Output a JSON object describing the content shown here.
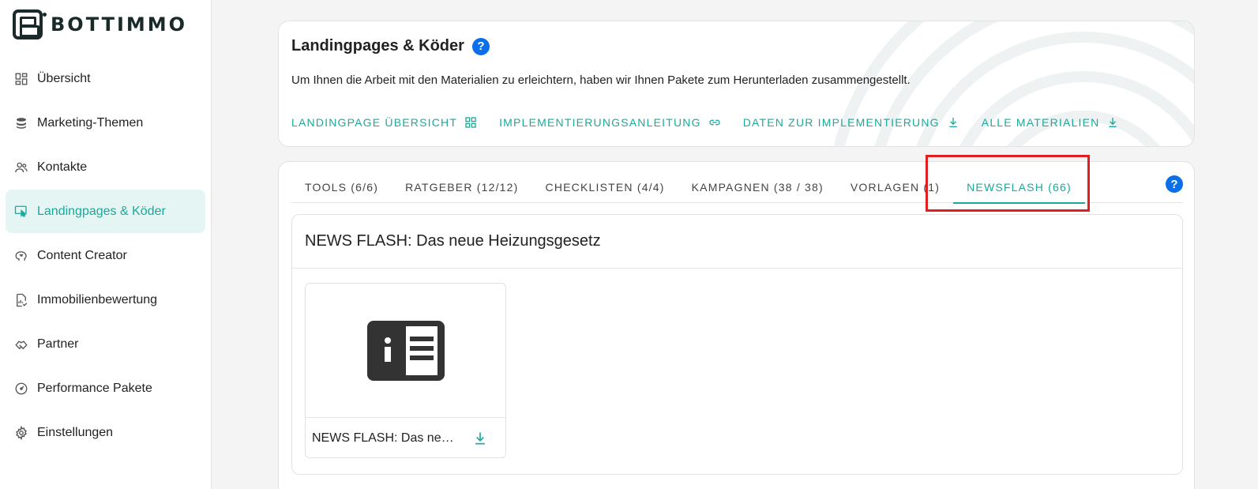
{
  "brand": {
    "name": "BOTTIMMO"
  },
  "sidebar": {
    "items": [
      {
        "label": "Übersicht",
        "icon": "dashboard-icon",
        "active": false
      },
      {
        "label": "Marketing-Themen",
        "icon": "layers-icon",
        "active": false
      },
      {
        "label": "Kontakte",
        "icon": "people-icon",
        "active": false
      },
      {
        "label": "Landingpages & Köder",
        "icon": "touch-screen-icon",
        "active": true
      },
      {
        "label": "Content Creator",
        "icon": "brain-icon",
        "active": false
      },
      {
        "label": "Immobilienbewertung",
        "icon": "document-chart-icon",
        "active": false
      },
      {
        "label": "Partner",
        "icon": "handshake-icon",
        "active": false
      },
      {
        "label": "Performance Pakete",
        "icon": "speedometer-icon",
        "active": false
      },
      {
        "label": "Einstellungen",
        "icon": "gear-icon",
        "active": false
      }
    ]
  },
  "header": {
    "title": "Landingpages & Köder",
    "help": "?",
    "description": "Um Ihnen die Arbeit mit den Materialien zu erleichtern, haben wir Ihnen Pakete zum Herunterladen zusammengestellt.",
    "links": [
      {
        "label": "LANDINGPAGE ÜBERSICHT",
        "icon": "grid-icon"
      },
      {
        "label": "IMPLEMENTIERUNGSANLEITUNG",
        "icon": "link-icon"
      },
      {
        "label": "DATEN ZUR IMPLEMENTIERUNG",
        "icon": "download-icon"
      },
      {
        "label": "ALLE MATERIALIEN",
        "icon": "download-icon"
      }
    ]
  },
  "tabs": [
    {
      "label": "TOOLS (6/6)",
      "active": false
    },
    {
      "label": "RATGEBER (12/12)",
      "active": false
    },
    {
      "label": "CHECKLISTEN (4/4)",
      "active": false
    },
    {
      "label": "KAMPAGNEN (38 / 38)",
      "active": false
    },
    {
      "label": "VORLAGEN (1)",
      "active": false
    },
    {
      "label": "NEWSFLASH (66)",
      "active": true
    }
  ],
  "tabs_help": "?",
  "section": {
    "title": "NEWS FLASH: Das neue Heizungsgesetz",
    "items": [
      {
        "name": "NEWS FLASH: Das neue Heizungsgesetz",
        "icon": "newspaper-info-icon"
      }
    ]
  },
  "colors": {
    "accent": "#1aa99b",
    "help": "#0a6fe8",
    "highlight": "#e02020",
    "active_bg": "#e4f5f3"
  }
}
